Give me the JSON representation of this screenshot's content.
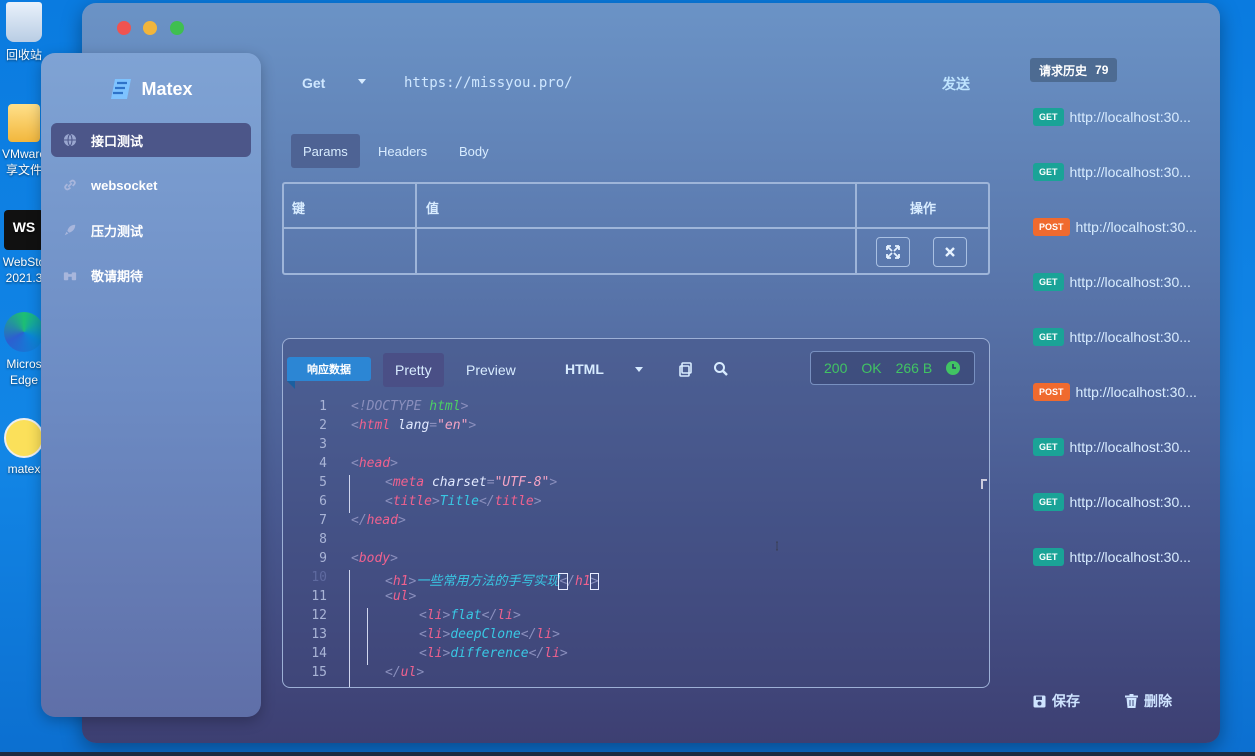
{
  "desktop": {
    "icons": [
      {
        "label": "回收站",
        "icon": "recycle-bin-icon"
      },
      {
        "label": "VMware\n享文件",
        "icon": "folder-icon"
      },
      {
        "label": "WebSto\n2021.3",
        "icon": "webstorm-icon"
      },
      {
        "label": "Micros\nEdge",
        "icon": "edge-icon"
      },
      {
        "label": "matex",
        "icon": "pikachu-icon"
      }
    ]
  },
  "app": {
    "name": "Matex"
  },
  "sidebar": {
    "items": [
      {
        "label": "接口测试",
        "icon": "globe-icon",
        "active": true
      },
      {
        "label": "websocket",
        "icon": "link-icon",
        "active": false
      },
      {
        "label": "压力测试",
        "icon": "rocket-icon",
        "active": false
      },
      {
        "label": "敬请期待",
        "icon": "binoculars-icon",
        "active": false
      }
    ]
  },
  "request": {
    "method": "Get",
    "url": "https://missyou.pro/",
    "send_label": "发送"
  },
  "tabs": [
    {
      "label": "Params",
      "active": true
    },
    {
      "label": "Headers",
      "active": false
    },
    {
      "label": "Body",
      "active": false
    }
  ],
  "params_table": {
    "headers": {
      "key": "键",
      "value": "值",
      "action": "操作"
    },
    "actions": [
      "expand-icon",
      "close-icon"
    ]
  },
  "response": {
    "tag": "响应数据",
    "tabs": [
      {
        "label": "Pretty",
        "active": true
      },
      {
        "label": "Preview",
        "active": false
      }
    ],
    "format": "HTML",
    "status_code": "200",
    "status_text": "OK",
    "size": "266 B",
    "code_lines": [
      "1",
      "2",
      "3",
      "4",
      "5",
      "6",
      "7",
      "8",
      "9",
      "10",
      "11",
      "12",
      "13",
      "14",
      "15"
    ]
  },
  "history": {
    "title": "请求历史",
    "count": "79",
    "items": [
      {
        "method": "GET",
        "url": "http://localhost:30..."
      },
      {
        "method": "GET",
        "url": "http://localhost:30..."
      },
      {
        "method": "POST",
        "url": "http://localhost:30..."
      },
      {
        "method": "GET",
        "url": "http://localhost:30..."
      },
      {
        "method": "GET",
        "url": "http://localhost:30..."
      },
      {
        "method": "POST",
        "url": "http://localhost:30..."
      },
      {
        "method": "GET",
        "url": "http://localhost:30..."
      },
      {
        "method": "GET",
        "url": "http://localhost:30..."
      },
      {
        "method": "GET",
        "url": "http://localhost:30..."
      }
    ]
  },
  "footer": {
    "save_label": "保存",
    "delete_label": "删除"
  }
}
